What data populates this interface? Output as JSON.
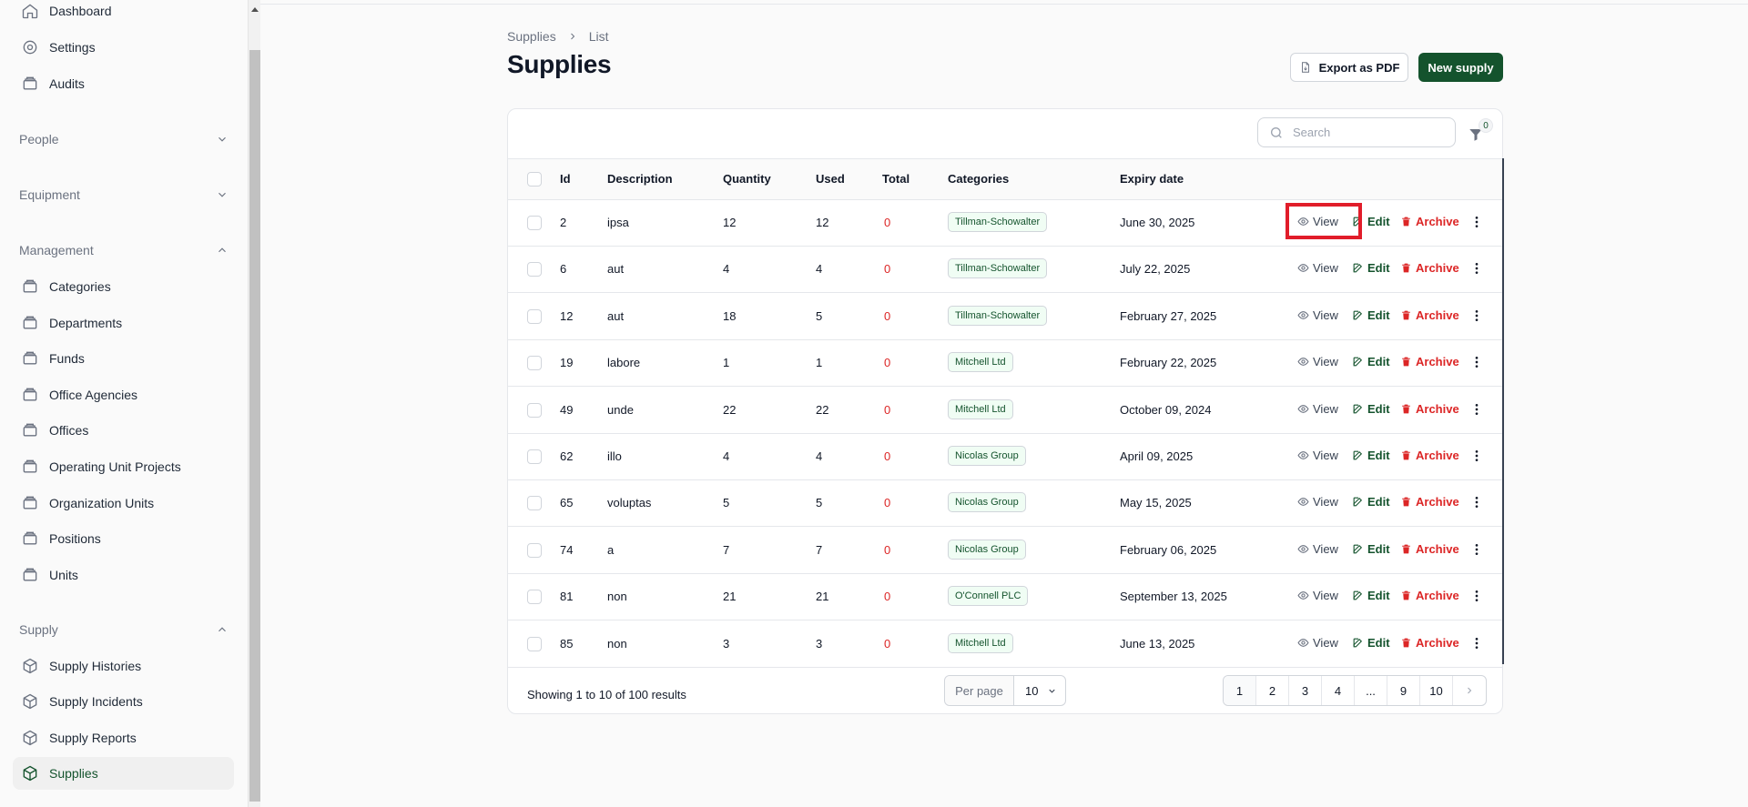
{
  "sidebar": {
    "top_items": [
      {
        "label": "Dashboard",
        "icon": "home-icon"
      },
      {
        "label": "Settings",
        "icon": "gear-icon"
      },
      {
        "label": "Audits",
        "icon": "folder-icon"
      }
    ],
    "groups": [
      {
        "label": "People",
        "expanded": false
      },
      {
        "label": "Equipment",
        "expanded": false
      },
      {
        "label": "Management",
        "expanded": true
      },
      {
        "label": "Supply",
        "expanded": true
      }
    ],
    "management_items": [
      "Categories",
      "Departments",
      "Funds",
      "Office Agencies",
      "Offices",
      "Operating Unit Projects",
      "Organization Units",
      "Positions",
      "Units"
    ],
    "supply_items": [
      "Supply Histories",
      "Supply Incidents",
      "Supply Reports",
      "Supplies"
    ],
    "active_item": "Supplies"
  },
  "breadcrumb": {
    "parent": "Supplies",
    "current": "List"
  },
  "page_title": "Supplies",
  "actions": {
    "export": "Export as PDF",
    "new": "New supply"
  },
  "search": {
    "placeholder": "Search"
  },
  "filter": {
    "count": "0"
  },
  "table": {
    "headers": {
      "id": "Id",
      "description": "Description",
      "quantity": "Quantity",
      "used": "Used",
      "total": "Total",
      "categories": "Categories",
      "expiry": "Expiry date"
    },
    "row_actions": {
      "view": "View",
      "edit": "Edit",
      "archive": "Archive"
    },
    "rows": [
      {
        "id": "2",
        "description": "ipsa",
        "quantity": "12",
        "used": "12",
        "total": "0",
        "category": "Tillman-Schowalter",
        "expiry": "June 30, 2025"
      },
      {
        "id": "6",
        "description": "aut",
        "quantity": "4",
        "used": "4",
        "total": "0",
        "category": "Tillman-Schowalter",
        "expiry": "July 22, 2025"
      },
      {
        "id": "12",
        "description": "aut",
        "quantity": "18",
        "used": "5",
        "total": "0",
        "category": "Tillman-Schowalter",
        "expiry": "February 27, 2025"
      },
      {
        "id": "19",
        "description": "labore",
        "quantity": "1",
        "used": "1",
        "total": "0",
        "category": "Mitchell Ltd",
        "expiry": "February 22, 2025"
      },
      {
        "id": "49",
        "description": "unde",
        "quantity": "22",
        "used": "22",
        "total": "0",
        "category": "Mitchell Ltd",
        "expiry": "October 09, 2024"
      },
      {
        "id": "62",
        "description": "illo",
        "quantity": "4",
        "used": "4",
        "total": "0",
        "category": "Nicolas Group",
        "expiry": "April 09, 2025"
      },
      {
        "id": "65",
        "description": "voluptas",
        "quantity": "5",
        "used": "5",
        "total": "0",
        "category": "Nicolas Group",
        "expiry": "May 15, 2025"
      },
      {
        "id": "74",
        "description": "a",
        "quantity": "7",
        "used": "7",
        "total": "0",
        "category": "Nicolas Group",
        "expiry": "February 06, 2025"
      },
      {
        "id": "81",
        "description": "non",
        "quantity": "21",
        "used": "21",
        "total": "0",
        "category": "O'Connell PLC",
        "expiry": "September 13, 2025"
      },
      {
        "id": "85",
        "description": "non",
        "quantity": "3",
        "used": "3",
        "total": "0",
        "category": "Mitchell Ltd",
        "expiry": "June 13, 2025"
      }
    ]
  },
  "footer": {
    "summary": "Showing 1 to 10 of 100 results",
    "per_page_label": "Per page",
    "per_page_value": "10",
    "pages": [
      "1",
      "2",
      "3",
      "4",
      "...",
      "9",
      "10"
    ],
    "current_page": "1"
  },
  "colors": {
    "brand": "#14532d",
    "danger": "#dc2626",
    "highlight": "#e11d2a"
  }
}
